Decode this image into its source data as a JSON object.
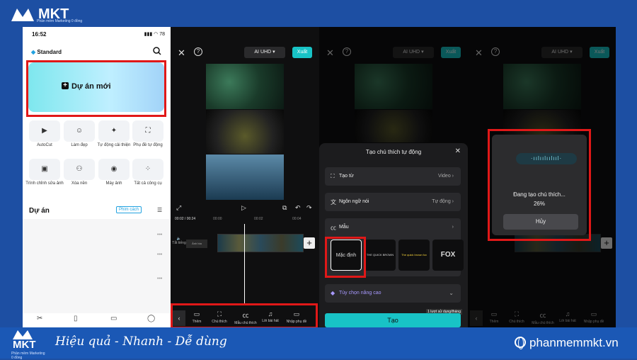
{
  "brand": {
    "name": "MKT",
    "tagline": "Phần mềm Marketing 0 đồng",
    "slogan": "Hiệu quả - Nhanh  - Dễ dùng",
    "website": "phanmemmkt.vn"
  },
  "panel1": {
    "time": "16:52",
    "battery": "78",
    "plan": "Standard",
    "new_project": "Dự án mới",
    "tools": [
      "AutoCut",
      "Làm đẹp",
      "Tự động cải thiện",
      "Phụ đề tự động",
      "Trình chỉnh sửa ảnh",
      "Xóa nền",
      "Máy ảnh",
      "Tất cả công cụ"
    ],
    "projects_title": "Dự án",
    "ad_label": "Phim cách"
  },
  "editor": {
    "quality": "AI UHD",
    "export": "Xuất",
    "time_current": "00:02",
    "time_total": "00:24",
    "mute": "Tắt tiếng",
    "cover": "Ảnh bìa",
    "ticks": [
      "00:00",
      "00:02",
      "00:04"
    ],
    "tools": [
      "Thêm",
      "Chú thích",
      "Mẫu chú thích",
      "Lời bài hát",
      "Nhập phụ đề"
    ]
  },
  "sheet": {
    "title": "Tạo chú thích tự động",
    "create_from": "Tạo từ",
    "create_from_value": "Video",
    "language": "Ngôn ngữ nói",
    "language_value": "Tự động",
    "template": "Mẫu",
    "default": "Mặc định",
    "tmpl2": "THE QUICK BROWN FOX",
    "tmpl3": "The quick brown fox",
    "tmpl4": "FOX",
    "advanced": "Tùy chọn nâng cao",
    "create": "Tạo",
    "usage": "1 lượt sử dụng/tháng"
  },
  "progress": {
    "status": "Đang tạo chú thích...",
    "percent": "26%",
    "cancel": "Hủy"
  }
}
